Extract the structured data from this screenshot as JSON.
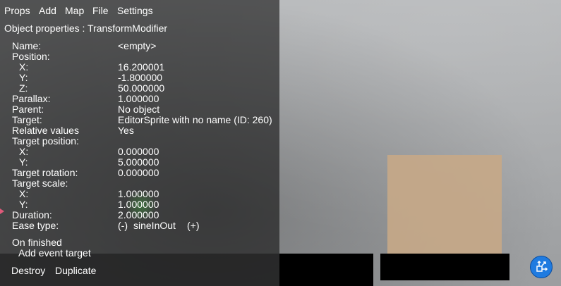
{
  "menu": [
    "Props",
    "Add",
    "Map",
    "File",
    "Settings"
  ],
  "panel_title": "Object properties : TransformModifier",
  "props": {
    "name_label": "Name:",
    "name_value": "<empty>",
    "position_label": "Position:",
    "x_label": "X:",
    "x_value": "16.200001",
    "y_label": "Y:",
    "y_value": "-1.800000",
    "z_label": "Z:",
    "z_value": "50.000000",
    "parallax_label": "Parallax:",
    "parallax_value": "1.000000",
    "parent_label": "Parent:",
    "parent_value": "No object",
    "target_label": "Target:",
    "target_value": "EditorSprite with no name (ID: 260)",
    "relative_label": "Relative values",
    "relative_value": "Yes",
    "target_position_label": "Target position:",
    "tp_x_label": "X:",
    "tp_x_value": "0.000000",
    "tp_y_label": "Y:",
    "tp_y_value": "5.000000",
    "target_rotation_label": "Target rotation:",
    "target_rotation_value": "0.000000",
    "target_scale_label": "Target scale:",
    "ts_x_label": "X:",
    "ts_x_value": "1.000000",
    "ts_y_label": "Y:",
    "ts_y_value": "1.000000",
    "duration_label": "Duration:",
    "duration_value": "2.000000",
    "ease_label": "Ease type:",
    "ease_minus": "(-)",
    "ease_value": "sineInOut",
    "ease_plus": "(+)"
  },
  "on_finished_label": "On finished",
  "add_event_target": "Add event target",
  "bottom_buttons": {
    "destroy": "Destroy",
    "duplicate": "Duplicate"
  },
  "icons": {
    "gizmo": "transform-gizmo-icon"
  },
  "colors": {
    "tan_block": "#c5a888",
    "gizmo": "#1f7be0"
  }
}
